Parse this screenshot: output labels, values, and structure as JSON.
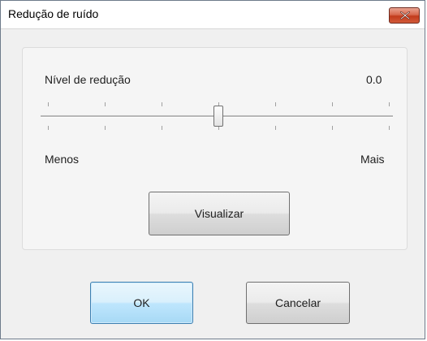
{
  "window": {
    "title": "Redução de ruído"
  },
  "noise": {
    "label": "Nível de redução",
    "value": "0.0",
    "slider_level": 0.5,
    "min_label": "Menos",
    "max_label": "Mais"
  },
  "buttons": {
    "preview": "Visualizar",
    "ok": "OK",
    "cancel": "Cancelar"
  },
  "colors": {
    "close_button": "#c94a2c",
    "default_button_border": "#3c7fb1"
  },
  "icons": {
    "close": "close-x-icon"
  }
}
